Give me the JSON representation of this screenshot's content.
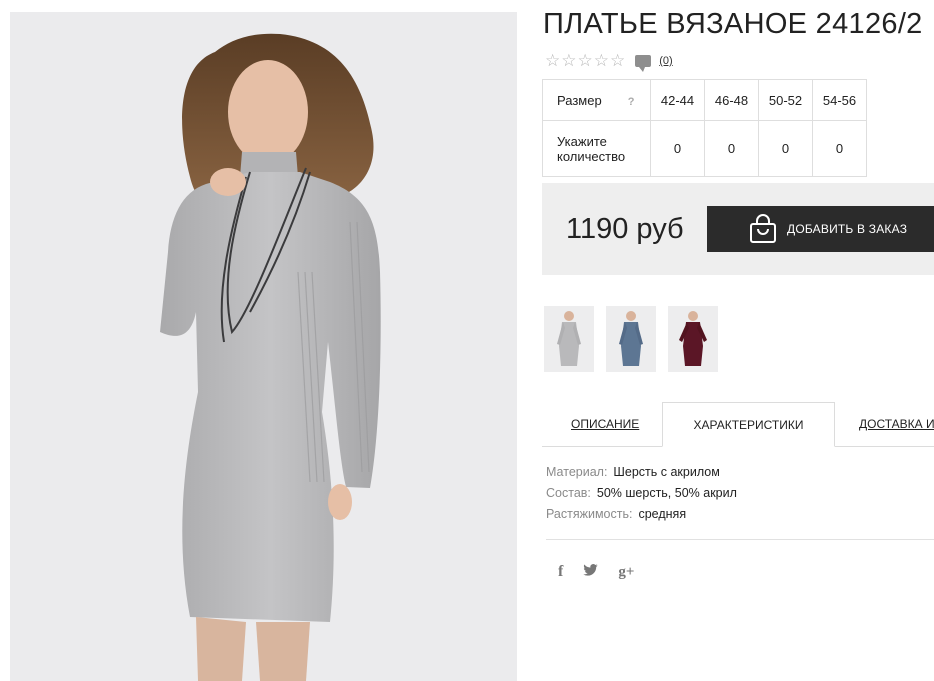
{
  "product": {
    "title": "ПЛАТЬЕ ВЯЗАНОЕ 24126/2",
    "rating_stars": 5,
    "rating_value": 0,
    "review_count": "(0)"
  },
  "sizes": {
    "header_label": "Размер",
    "help_label": "?",
    "quantity_label_line1": "Укажите",
    "quantity_label_line2": "количество",
    "columns": [
      {
        "size": "42-44",
        "qty": "0"
      },
      {
        "size": "46-48",
        "qty": "0"
      },
      {
        "size": "50-52",
        "qty": "0"
      },
      {
        "size": "54-56",
        "qty": "0"
      }
    ]
  },
  "purchase": {
    "price": "1190 руб",
    "add_button": "ДОБАВИТЬ В ЗАКАЗ"
  },
  "thumbnails": [
    {
      "color_name": "grey",
      "color": "#b9b9bb"
    },
    {
      "color_name": "blue",
      "color": "#5d7693"
    },
    {
      "color_name": "burgundy",
      "color": "#5b1626"
    }
  ],
  "tabs": {
    "description": "ОПИСАНИЕ",
    "characteristics": "ХАРАКТЕРИСТИКИ",
    "delivery": "ДОСТАВКА И"
  },
  "characteristics": [
    {
      "key": "Материал:",
      "value": "Шерсть с акрилом"
    },
    {
      "key": "Состав:",
      "value": "50% шерсть, 50% акрил"
    },
    {
      "key": "Растяжимость:",
      "value": "средняя"
    }
  ],
  "social": {
    "facebook": "f",
    "twitter_icon": "twitter-bird-icon",
    "google": "g+"
  },
  "colors": {
    "button_bg": "#2b2b2b",
    "price_box_bg": "#eeeeee",
    "image_bg": "#ebebed",
    "dress_grey": "#b9b9bb"
  }
}
